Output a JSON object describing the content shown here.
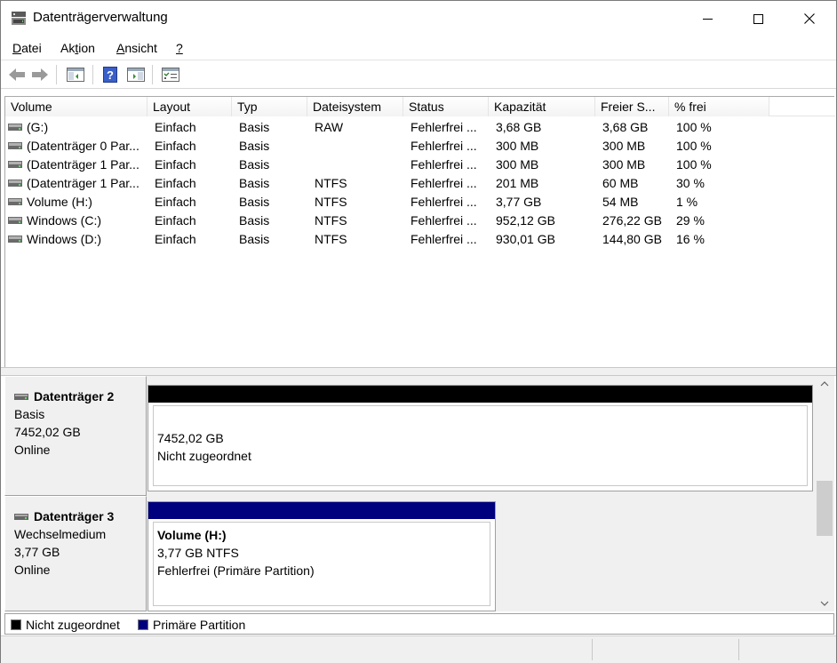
{
  "window": {
    "title": "Datenträgerverwaltung",
    "minimize": "Minimieren",
    "maximize": "Maximieren",
    "close": "Schließen"
  },
  "menu": [
    {
      "label": "Datei",
      "underline": "D",
      "rest": "atei"
    },
    {
      "label": "Aktion",
      "prefix": "Ak",
      "underline": "t",
      "rest": "ion"
    },
    {
      "label": "Ansicht",
      "underline": "A",
      "rest": "nsicht"
    },
    {
      "label": "?",
      "underline": "?",
      "rest": ""
    }
  ],
  "toolbar": {
    "icons": [
      "back-arrow-icon",
      "forward-arrow-icon",
      "show-hide-console-tree-icon",
      "help-icon",
      "show-action-pane-icon",
      "properties-icon"
    ]
  },
  "volumes": {
    "columns": [
      "Volume",
      "Layout",
      "Typ",
      "Dateisystem",
      "Status",
      "Kapazität",
      "Freier S...",
      "% frei"
    ],
    "rows": [
      {
        "volume": " (G:)",
        "layout": "Einfach",
        "typ": "Basis",
        "fs": "RAW",
        "status": "Fehlerfrei ...",
        "kap": "3,68 GB",
        "frei": "3,68 GB",
        "pct": "100 %"
      },
      {
        "volume": "(Datenträger 0 Par...",
        "layout": "Einfach",
        "typ": "Basis",
        "fs": "",
        "status": "Fehlerfrei ...",
        "kap": "300 MB",
        "frei": "300 MB",
        "pct": "100 %"
      },
      {
        "volume": "(Datenträger 1 Par...",
        "layout": "Einfach",
        "typ": "Basis",
        "fs": "",
        "status": "Fehlerfrei ...",
        "kap": "300 MB",
        "frei": "300 MB",
        "pct": "100 %"
      },
      {
        "volume": "(Datenträger 1 Par...",
        "layout": "Einfach",
        "typ": "Basis",
        "fs": "NTFS",
        "status": "Fehlerfrei ...",
        "kap": "201 MB",
        "frei": "60 MB",
        "pct": "30 %"
      },
      {
        "volume": "Volume (H:)",
        "layout": "Einfach",
        "typ": "Basis",
        "fs": "NTFS",
        "status": "Fehlerfrei ...",
        "kap": "3,77 GB",
        "frei": "54 MB",
        "pct": "1 %"
      },
      {
        "volume": "Windows (C:)",
        "layout": "Einfach",
        "typ": "Basis",
        "fs": "NTFS",
        "status": "Fehlerfrei ...",
        "kap": "952,12 GB",
        "frei": "276,22 GB",
        "pct": "29 %"
      },
      {
        "volume": "Windows (D:)",
        "layout": "Einfach",
        "typ": "Basis",
        "fs": "NTFS",
        "status": "Fehlerfrei ...",
        "kap": "930,01 GB",
        "frei": "144,80 GB",
        "pct": "16 %"
      }
    ]
  },
  "disks": [
    {
      "name": "Datenträger 2",
      "type": "Basis",
      "size": "7452,02 GB",
      "state": "Online",
      "partitions": [
        {
          "title": "",
          "line1": "7452,02 GB",
          "line2": "Nicht zugeordnet",
          "bar_color": "#000000"
        }
      ]
    },
    {
      "name": "Datenträger 3",
      "type": "Wechselmedium",
      "size": "3,77 GB",
      "state": "Online",
      "partitions": [
        {
          "title": "Volume  (H:)",
          "line1": "3,77 GB NTFS",
          "line2": "Fehlerfrei (Primäre Partition)",
          "bar_color": "#00007f"
        }
      ]
    }
  ],
  "legend": [
    {
      "label": "Nicht zugeordnet",
      "color": "#000000"
    },
    {
      "label": "Primäre Partition",
      "color": "#00007f"
    }
  ],
  "colors": {
    "unallocated": "#000000",
    "primary_partition": "#00007f",
    "pane_background": "#f0f0f0"
  }
}
